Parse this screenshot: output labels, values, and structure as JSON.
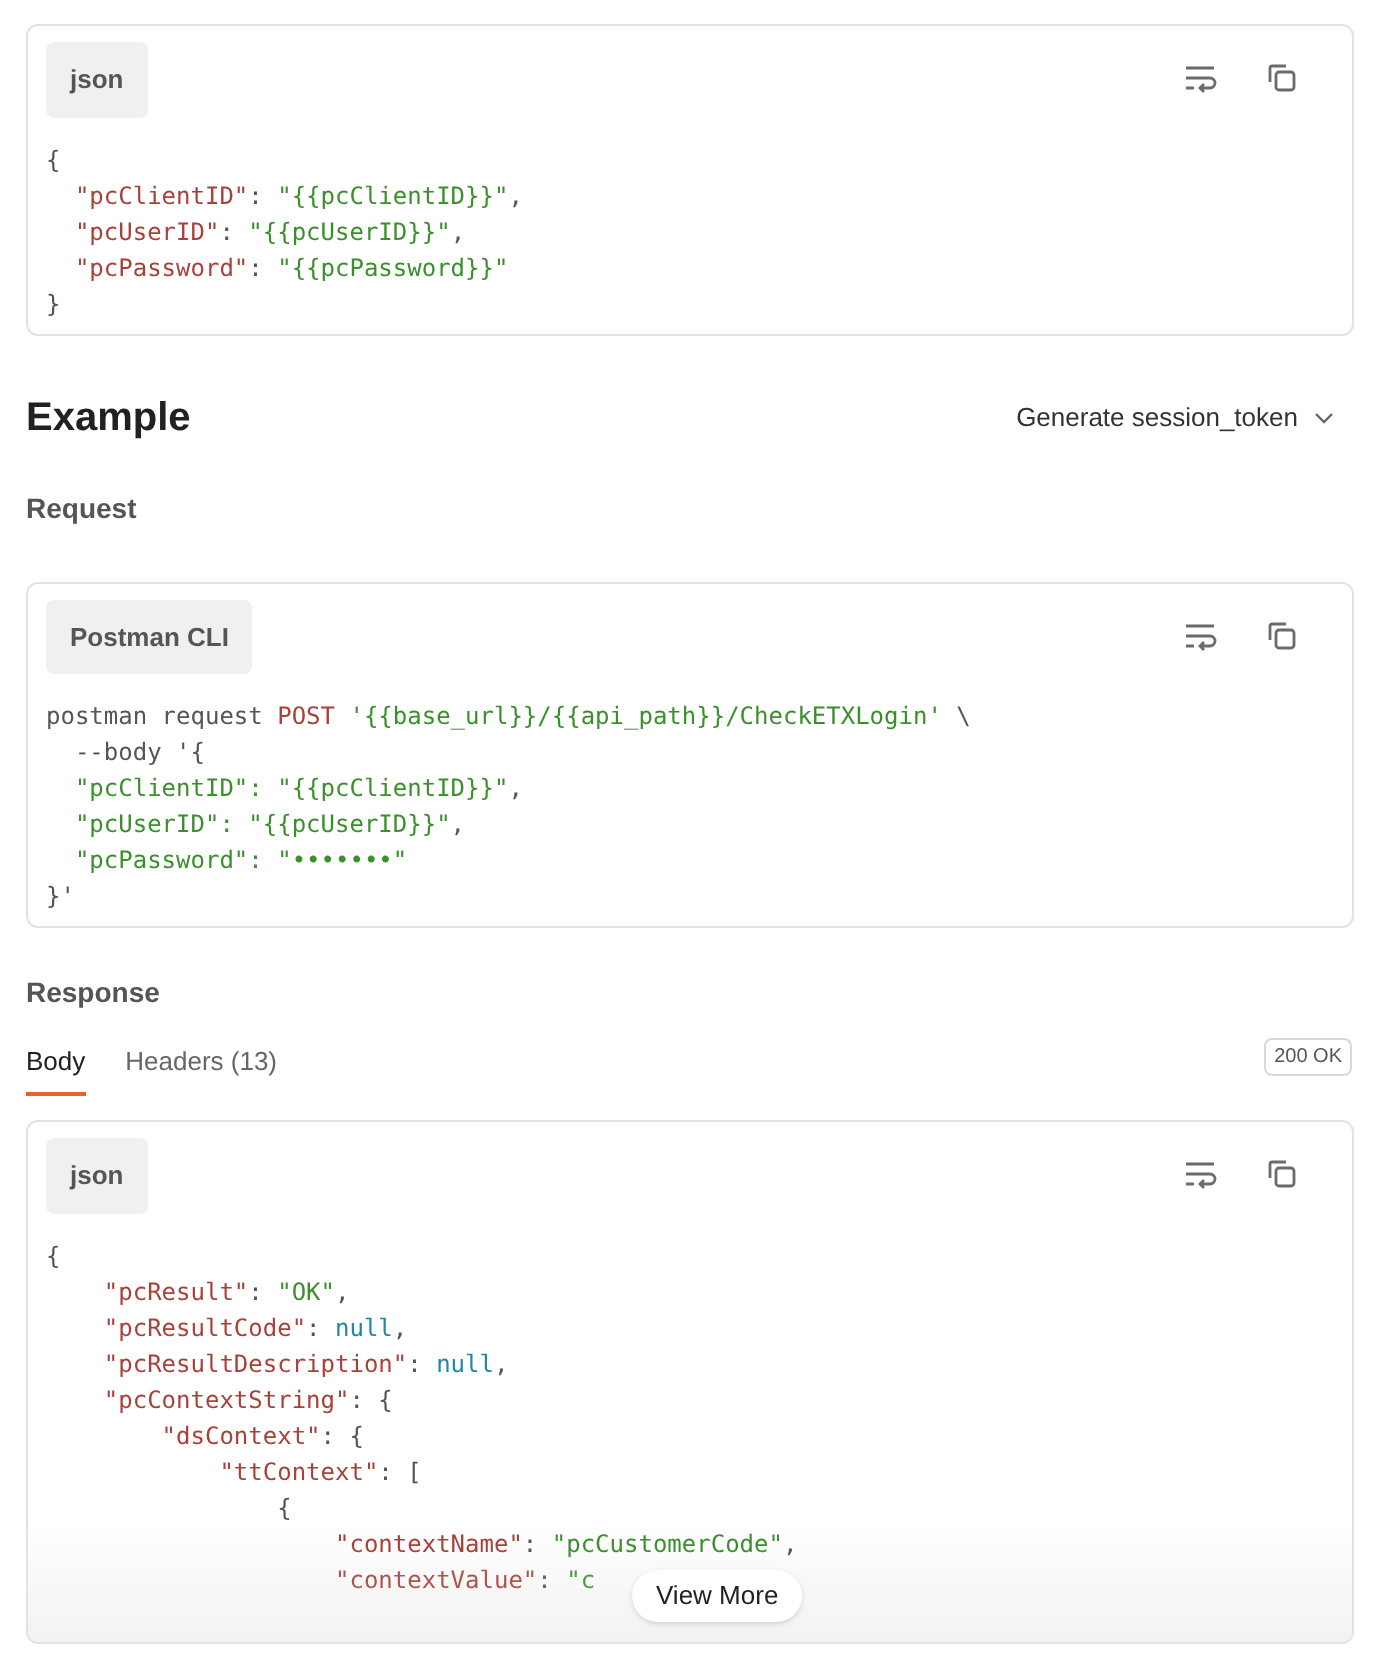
{
  "body_block": {
    "language": "json",
    "lines": [
      [
        {
          "kind": "punct",
          "text": "{"
        }
      ],
      [
        {
          "kind": "key",
          "text": "  \"pcClientID\""
        },
        {
          "kind": "punct",
          "text": ": "
        },
        {
          "kind": "str",
          "text": "\"{{pcClientID}}\""
        },
        {
          "kind": "punct",
          "text": ","
        }
      ],
      [
        {
          "kind": "key",
          "text": "  \"pcUserID\""
        },
        {
          "kind": "punct",
          "text": ": "
        },
        {
          "kind": "str",
          "text": "\"{{pcUserID}}\""
        },
        {
          "kind": "punct",
          "text": ","
        }
      ],
      [
        {
          "kind": "key",
          "text": "  \"pcPassword\""
        },
        {
          "kind": "punct",
          "text": ": "
        },
        {
          "kind": "str",
          "text": "\"{{pcPassword}}\""
        }
      ],
      [
        {
          "kind": "punct",
          "text": "}"
        }
      ]
    ]
  },
  "example": {
    "title": "Example",
    "dropdown": "Generate session_token"
  },
  "request": {
    "title": "Request",
    "language": "Postman CLI",
    "lines": [
      [
        {
          "kind": "punct",
          "text": "postman request "
        },
        {
          "kind": "key",
          "text": "POST"
        },
        {
          "kind": "str",
          "text": " '{{base_url}}/{{api_path}}/CheckETXLogin'"
        },
        {
          "kind": "punct",
          "text": " \\"
        }
      ],
      [
        {
          "kind": "punct",
          "text": "  --body '{"
        }
      ],
      [
        {
          "kind": "str",
          "text": "  \"pcClientID\": \"{{pcClientID}}\""
        },
        {
          "kind": "punct",
          "text": ","
        }
      ],
      [
        {
          "kind": "str",
          "text": "  \"pcUserID\": \"{{pcUserID}}\""
        },
        {
          "kind": "punct",
          "text": ","
        }
      ],
      [
        {
          "kind": "str",
          "text": "  \"pcPassword\": \"•••••••\""
        }
      ],
      [
        {
          "kind": "punct",
          "text": "}'"
        }
      ]
    ]
  },
  "response": {
    "title": "Response",
    "tabs": [
      {
        "label": "Body",
        "selected": true
      },
      {
        "label": "Headers (13)",
        "selected": false
      }
    ],
    "status": "200 OK",
    "language": "json",
    "view_more": "View More",
    "lines": [
      [
        {
          "kind": "punct",
          "text": "{"
        }
      ],
      [
        {
          "kind": "key",
          "text": "    \"pcResult\""
        },
        {
          "kind": "punct",
          "text": ": "
        },
        {
          "kind": "str",
          "text": "\"OK\""
        },
        {
          "kind": "punct",
          "text": ","
        }
      ],
      [
        {
          "kind": "key",
          "text": "    \"pcResultCode\""
        },
        {
          "kind": "punct",
          "text": ": "
        },
        {
          "kind": "null",
          "text": "null"
        },
        {
          "kind": "punct",
          "text": ","
        }
      ],
      [
        {
          "kind": "key",
          "text": "    \"pcResultDescription\""
        },
        {
          "kind": "punct",
          "text": ": "
        },
        {
          "kind": "null",
          "text": "null"
        },
        {
          "kind": "punct",
          "text": ","
        }
      ],
      [
        {
          "kind": "key",
          "text": "    \"pcContextString\""
        },
        {
          "kind": "punct",
          "text": ": {"
        }
      ],
      [
        {
          "kind": "key",
          "text": "        \"dsContext\""
        },
        {
          "kind": "punct",
          "text": ": {"
        }
      ],
      [
        {
          "kind": "key",
          "text": "            \"ttContext\""
        },
        {
          "kind": "punct",
          "text": ": ["
        }
      ],
      [
        {
          "kind": "punct",
          "text": "                {"
        }
      ],
      [
        {
          "kind": "key",
          "text": "                    \"contextName\""
        },
        {
          "kind": "punct",
          "text": ": "
        },
        {
          "kind": "str",
          "text": "\"pcCustomerCode\""
        },
        {
          "kind": "punct",
          "text": ","
        }
      ],
      [
        {
          "kind": "key",
          "text": "                    \"contextValue\""
        },
        {
          "kind": "punct",
          "text": ": "
        },
        {
          "kind": "str",
          "text": "\"c"
        }
      ]
    ]
  }
}
